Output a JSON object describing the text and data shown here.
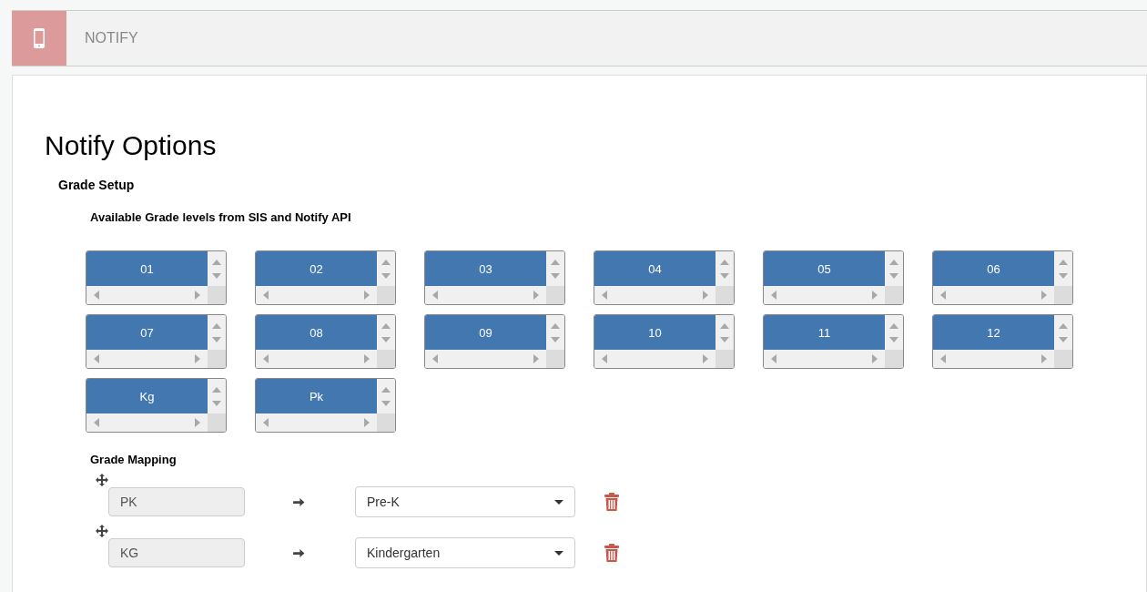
{
  "header": {
    "title": "NOTIFY"
  },
  "page": {
    "title": "Notify Options",
    "section": "Grade Setup",
    "subsection": "Available Grade levels from SIS and Notify API"
  },
  "grades": [
    {
      "label": "01",
      "selected": true
    },
    {
      "label": "02",
      "selected": true
    },
    {
      "label": "03",
      "selected": true
    },
    {
      "label": "04",
      "selected": true
    },
    {
      "label": "05",
      "selected": true
    },
    {
      "label": "06",
      "selected": true
    },
    {
      "label": "07",
      "selected": true
    },
    {
      "label": "08",
      "selected": true
    },
    {
      "label": "09",
      "selected": true
    },
    {
      "label": "10",
      "selected": true
    },
    {
      "label": "11",
      "selected": true
    },
    {
      "label": "12",
      "selected": true
    },
    {
      "label": "Kg",
      "selected": true
    },
    {
      "label": "Pk",
      "selected": true
    }
  ],
  "mapping": {
    "title": "Grade Mapping",
    "rows": [
      {
        "code": "PK",
        "value": "Pre-K"
      },
      {
        "code": "KG",
        "value": "Kindergarten"
      }
    ]
  }
}
